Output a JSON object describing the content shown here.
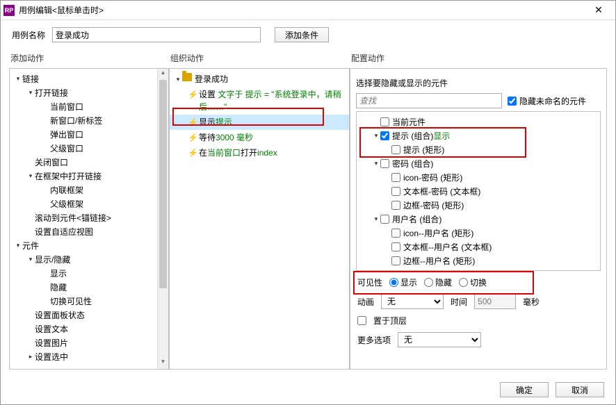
{
  "window": {
    "app_glyph": "RP",
    "title": "用例编辑<鼠标单击时>",
    "close": "✕"
  },
  "name_row": {
    "label": "用例名称",
    "value": "登录成功",
    "add_condition": "添加条件"
  },
  "left": {
    "header": "添加动作",
    "tree": [
      {
        "lvl": 0,
        "caret": "▾",
        "label": "链接"
      },
      {
        "lvl": 1,
        "caret": "▾",
        "label": "打开链接"
      },
      {
        "lvl": 2,
        "caret": "",
        "label": "当前窗口"
      },
      {
        "lvl": 2,
        "caret": "",
        "label": "新窗口/新标签"
      },
      {
        "lvl": 2,
        "caret": "",
        "label": "弹出窗口"
      },
      {
        "lvl": 2,
        "caret": "",
        "label": "父级窗口"
      },
      {
        "lvl": 1,
        "caret": "",
        "label": "关闭窗口"
      },
      {
        "lvl": 1,
        "caret": "▾",
        "label": "在框架中打开链接"
      },
      {
        "lvl": 2,
        "caret": "",
        "label": "内联框架"
      },
      {
        "lvl": 2,
        "caret": "",
        "label": "父级框架"
      },
      {
        "lvl": 1,
        "caret": "",
        "label": "滚动到元件<锚链接>"
      },
      {
        "lvl": 1,
        "caret": "",
        "label": "设置自适应视图"
      },
      {
        "lvl": 0,
        "caret": "▾",
        "label": "元件"
      },
      {
        "lvl": 1,
        "caret": "▾",
        "label": "显示/隐藏"
      },
      {
        "lvl": 2,
        "caret": "",
        "label": "显示"
      },
      {
        "lvl": 2,
        "caret": "",
        "label": "隐藏"
      },
      {
        "lvl": 2,
        "caret": "",
        "label": "切换可见性"
      },
      {
        "lvl": 1,
        "caret": "",
        "label": "设置面板状态"
      },
      {
        "lvl": 1,
        "caret": "",
        "label": "设置文本"
      },
      {
        "lvl": 1,
        "caret": "",
        "label": "设置图片"
      },
      {
        "lvl": 1,
        "caret": "▸",
        "label": "设置选中"
      }
    ]
  },
  "mid": {
    "header": "组织动作",
    "case_name": "登录成功",
    "act1_pre": "设置 ",
    "act1_a": "文字于 提示 = \"系统登录中，请稍后……\"",
    "act2_a": "显示 ",
    "act2_b": "提示",
    "act3_a": "等待 ",
    "act3_b": "3000 毫秒",
    "act4_a": "在 ",
    "act4_b": "当前窗口",
    "act4_c": " 打开 ",
    "act4_d": "index"
  },
  "right": {
    "header": "配置动作",
    "sub_header": "选择要隐藏或显示的元件",
    "search_placeholder": "查找",
    "hide_unnamed": "隐藏未命名的元件",
    "widgets": [
      {
        "lvl": 0,
        "caret": "",
        "checked": false,
        "label": "当前元件",
        "suffix": ""
      },
      {
        "lvl": 0,
        "caret": "▾",
        "checked": true,
        "label": "提示 (组合)",
        "suffix": "显示",
        "green": true
      },
      {
        "lvl": 1,
        "caret": "",
        "checked": false,
        "label": "提示 (矩形)",
        "suffix": ""
      },
      {
        "lvl": 0,
        "caret": "▾",
        "checked": false,
        "label": "密码 (组合)",
        "suffix": ""
      },
      {
        "lvl": 1,
        "caret": "",
        "checked": false,
        "label": "icon-密码 (矩形)",
        "suffix": ""
      },
      {
        "lvl": 1,
        "caret": "",
        "checked": false,
        "label": "文本框-密码 (文本框)",
        "suffix": ""
      },
      {
        "lvl": 1,
        "caret": "",
        "checked": false,
        "label": "边框-密码 (矩形)",
        "suffix": ""
      },
      {
        "lvl": 0,
        "caret": "▾",
        "checked": false,
        "label": "用户名 (组合)",
        "suffix": ""
      },
      {
        "lvl": 1,
        "caret": "",
        "checked": false,
        "label": "icon--用户名 (矩形)",
        "suffix": ""
      },
      {
        "lvl": 1,
        "caret": "",
        "checked": false,
        "label": "文本框--用户名 (文本框)",
        "suffix": ""
      },
      {
        "lvl": 1,
        "caret": "",
        "checked": false,
        "label": "边框--用户名 (矩形)",
        "suffix": ""
      }
    ],
    "visibility": {
      "label": "可见性",
      "show": "显示",
      "hide": "隐藏",
      "toggle": "切换"
    },
    "anim": {
      "label": "动画",
      "value": "无",
      "time_label": "时间",
      "time_value": "500",
      "unit": "毫秒"
    },
    "top": "置于顶层",
    "more": {
      "label": "更多选项",
      "value": "无"
    }
  },
  "footer": {
    "ok": "确定",
    "cancel": "取消"
  }
}
